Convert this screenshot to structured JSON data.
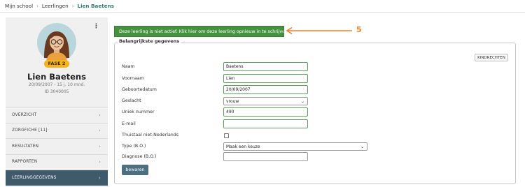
{
  "breadcrumb": {
    "items": [
      "Mijn school",
      "Leerlingen"
    ],
    "current": "Lien Baetens"
  },
  "student": {
    "name": "Lien Baetens",
    "meta": "20/09/2007 - 15 j. 10 mnd.",
    "id_label": "ID 3040005",
    "badge": "FASE 2"
  },
  "nav": [
    {
      "label": "OVERZICHT"
    },
    {
      "label": "ZORGFICHE [11]"
    },
    {
      "label": "RESULTATEN"
    },
    {
      "label": "RAPPORTEN"
    },
    {
      "label": "LEERLINGGEGEVENS"
    }
  ],
  "alert": {
    "label": "Deze leerling is niet actief. Klik hier om deze leerling opnieuw in te schrijven"
  },
  "annotation": {
    "number": "5",
    "color": "#ee8227"
  },
  "form": {
    "legend": "Belangrijkste gegevens",
    "kind_button": "KINDRECHTEN",
    "fields": {
      "naam": {
        "label": "Naam",
        "value": "Baetens"
      },
      "voornaam": {
        "label": "Voornaam",
        "value": "Lien"
      },
      "geboortedatum": {
        "label": "Geboortedatum",
        "value": "20/09/2007"
      },
      "geslacht": {
        "label": "Geslacht",
        "value": "vrouw"
      },
      "uniek": {
        "label": "Uniek nummer",
        "value": "490"
      },
      "email": {
        "label": "E-mail",
        "value": ""
      },
      "thuistaal": {
        "label": "Thuistaal niet-Nederlands",
        "checked": false
      },
      "type": {
        "label": "Type (B.O.)",
        "value": "Maak een keuze"
      },
      "diagnose": {
        "label": "Diagnose (B.O.)",
        "value": ""
      }
    },
    "save_label": "bewaren"
  },
  "colors": {
    "accent_green": "#45933f",
    "nav_active": "#3f5a6b",
    "badge": "#f5b21b",
    "save": "#4d6e7e"
  }
}
